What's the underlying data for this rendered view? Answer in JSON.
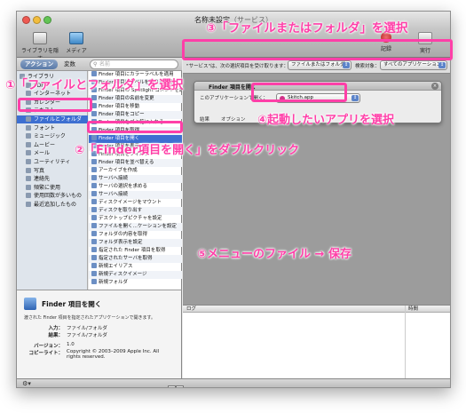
{
  "window": {
    "title": "名称未設定",
    "subtitle": "（サービス）"
  },
  "toolbar": {
    "library": "ライブラリを隠す",
    "media": "メディア",
    "record": "記録",
    "run": "実行"
  },
  "left_pane": {
    "tabs": [
      "アクション",
      "変数"
    ],
    "search_placeholder": "名前",
    "library_items": [
      {
        "label": "ライブラリ",
        "selected": false
      },
      {
        "label": "PDF",
        "selected": false
      },
      {
        "label": "インターネット",
        "selected": false
      },
      {
        "label": "カレンダー",
        "selected": false
      },
      {
        "label": "テキスト",
        "selected": false
      },
      {
        "label": "ファイルとフォルダ",
        "selected": true
      },
      {
        "label": "フォント",
        "selected": false
      },
      {
        "label": "ミュージック",
        "selected": false
      },
      {
        "label": "ムービー",
        "selected": false
      },
      {
        "label": "メール",
        "selected": false
      },
      {
        "label": "ユーティリティ",
        "selected": false
      },
      {
        "label": "写真",
        "selected": false
      },
      {
        "label": "連絡先",
        "selected": false
      },
      {
        "label": "頻繁に使用",
        "selected": false
      },
      {
        "label": "使用回数が多いもの",
        "selected": false
      },
      {
        "label": "最近追加したもの",
        "selected": false
      }
    ],
    "actions": [
      {
        "label": "Finder 項目にカラーラベルを適用",
        "selected": false
      },
      {
        "label": "Finder 項目にラベルを割り当てる",
        "selected": false
      },
      {
        "label": "Finder 項目の Spotlight コメントを設定",
        "selected": false
      },
      {
        "label": "Finder 項目の名前を変更",
        "selected": false
      },
      {
        "label": "Finder 項目を移動",
        "selected": false
      },
      {
        "label": "Finder 項目をコピー",
        "selected": false
      },
      {
        "label": "Finder 項目をゴミ箱に入れる",
        "selected": false
      },
      {
        "label": "Finder 項目を取得",
        "selected": false
      },
      {
        "label": "Finder 項目を開く",
        "selected": true
      },
      {
        "label": "Finder 項目を表示",
        "selected": false
      },
      {
        "label": "Finder 項目をフィルタ",
        "selected": false
      },
      {
        "label": "Finder 項目を並べ替える",
        "selected": false
      },
      {
        "label": "アーカイブを作成",
        "selected": false
      },
      {
        "label": "サーバへ接続",
        "selected": false
      },
      {
        "label": "サーバの選択を求める",
        "selected": false
      },
      {
        "label": "サーバへ接続",
        "selected": false
      },
      {
        "label": "ディスクイメージをマウント",
        "selected": false
      },
      {
        "label": "ディスクを取り出す",
        "selected": false
      },
      {
        "label": "デスクトップピクチャを設定",
        "selected": false
      },
      {
        "label": "ファイルを開く…ケーションを設定",
        "selected": false
      },
      {
        "label": "フォルダの内容を取得",
        "selected": false
      },
      {
        "label": "フォルダ表示を設定",
        "selected": false
      },
      {
        "label": "指定された Finder 項目を取得",
        "selected": false
      },
      {
        "label": "指定されたサーバを取得",
        "selected": false
      },
      {
        "label": "新規エイリアス",
        "selected": false
      },
      {
        "label": "新規ディスクイメージ",
        "selected": false
      },
      {
        "label": "新規フォルダ",
        "selected": false
      }
    ]
  },
  "description": {
    "title": "Finder 項目を開く",
    "text": "渡された Finder 項目を指定されたアプリケーションで開きます。",
    "input_key": "入力：",
    "input_value": "ファイル/フォルダ",
    "result_key": "結果：",
    "result_value": "ファイル/フォルダ",
    "version_key": "バージョン：",
    "version_value": "1.0",
    "copyright_key": "コピーライト：",
    "copyright_value": "Copyright © 2003–2009 Apple Inc. All rights reserved."
  },
  "service_bar": {
    "prefix": "\"サービス\"は、次の選択項目を受け取ります：",
    "input_type": "ファイルまたはフォルダ",
    "target_label": "検索対象：",
    "target_value": "すべてのアプリケーション"
  },
  "action_box": {
    "title": "Finder 項目を開く",
    "label": "このアプリケーションで開く：",
    "app": "Skitch.app",
    "result_tab": "結果",
    "options_tab": "オプション"
  },
  "log": {
    "col_log": "ログ",
    "col_time": "時間"
  },
  "annotations": {
    "a1": "①「ファイルとフォルダ」を選択",
    "a2": "②「Finder項目を開く」をダブルクリック",
    "a3": "③「ファイルまたはフォルダ」を選択",
    "a4": "④起動したいアプリを選択",
    "a5": "⑤メニューのファイル → 保存"
  },
  "colors": {
    "annotation": "#ff3fa8",
    "selection": "#3d6fd1"
  }
}
